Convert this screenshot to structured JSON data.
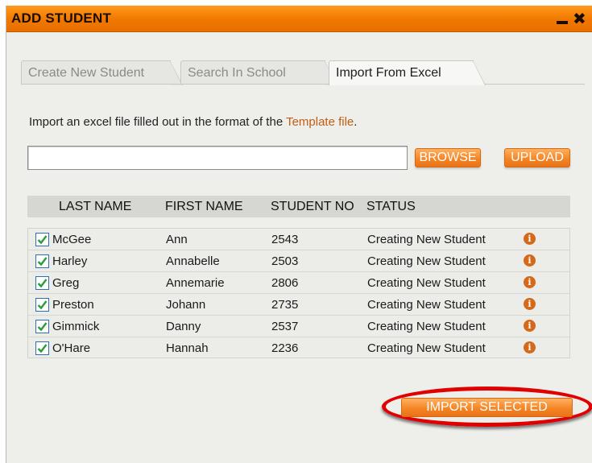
{
  "window": {
    "title": "ADD STUDENT"
  },
  "tabs": [
    {
      "label": "Create New Student",
      "active": false
    },
    {
      "label": "Search In School",
      "active": false
    },
    {
      "label": "Import From Excel",
      "active": true
    }
  ],
  "import": {
    "instructions_prefix": "Import an excel file filled out in the format of the ",
    "template_link": "Template file",
    "instructions_suffix": ".",
    "file_value": "",
    "browse_label": "BROWSE",
    "upload_label": "UPLOAD"
  },
  "table": {
    "columns": [
      "LAST NAME",
      "FIRST NAME",
      "STUDENT NO",
      "STATUS"
    ],
    "rows": [
      {
        "checked": true,
        "last": "McGee",
        "first": "Ann",
        "no": "2543",
        "status": "Creating New Student"
      },
      {
        "checked": true,
        "last": "Harley",
        "first": "Annabelle",
        "no": "2503",
        "status": "Creating New Student"
      },
      {
        "checked": true,
        "last": "Greg",
        "first": "Annemarie",
        "no": "2806",
        "status": "Creating New Student"
      },
      {
        "checked": true,
        "last": "Preston",
        "first": "Johann",
        "no": "2735",
        "status": "Creating New Student"
      },
      {
        "checked": true,
        "last": "Gimmick",
        "first": "Danny",
        "no": "2537",
        "status": "Creating New Student"
      },
      {
        "checked": true,
        "last": "O'Hare",
        "first": "Hannah",
        "no": "2236",
        "status": "Creating New Student"
      }
    ]
  },
  "actions": {
    "import_selected_label": "IMPORT SELECTED"
  },
  "colors": {
    "accent": "#f48322",
    "titlebar": "#f07800",
    "highlight": "#e00000",
    "link": "#c25e14"
  }
}
